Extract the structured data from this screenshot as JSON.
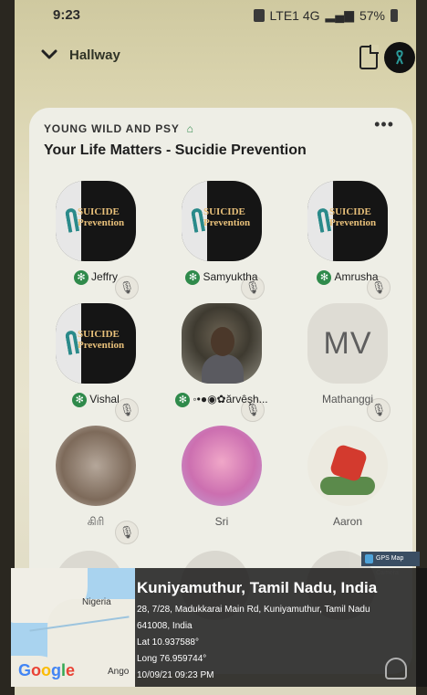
{
  "status_bar": {
    "time": "9:23",
    "network": "LTE1 4G",
    "battery": "57%"
  },
  "header": {
    "room_group": "Hallway"
  },
  "room": {
    "club": "YOUNG WILD AND PSY",
    "title": "Your Life Matters - Sucidie Prevention",
    "more": "•••"
  },
  "poster": {
    "line1": "SUICIDE",
    "line2": "Prevention"
  },
  "speakers": [
    {
      "name": "Jeffry",
      "moderator": true,
      "avatar": "poster"
    },
    {
      "name": "Samyuktha",
      "moderator": true,
      "avatar": "poster"
    },
    {
      "name": "Amrusha",
      "moderator": true,
      "avatar": "poster"
    },
    {
      "name": "Vishal",
      "moderator": true,
      "avatar": "poster"
    },
    {
      "name": "◦•●◉✿ărvêşh...",
      "moderator": true,
      "avatar": "photo"
    },
    {
      "name": "Mathanggi",
      "moderator": false,
      "avatar": "initials",
      "initials": "MV"
    },
    {
      "name": "கிரி",
      "moderator": false,
      "avatar": "photo"
    },
    {
      "name": "Sri",
      "moderator": false,
      "avatar": "photo"
    },
    {
      "name": "Aaron",
      "moderator": false,
      "avatar": "photo"
    }
  ],
  "gps": {
    "badge": "GPS Map Camera",
    "place": "Kuniyamuthur, Tamil Nadu, India",
    "address1": "28, 7/28, Madukkarai Main Rd, Kuniyamuthur, Tamil Nadu",
    "address2": "641008, India",
    "lat": "Lat 10.937588°",
    "long": "Long 76.959744°",
    "datetime": "10/09/21 09:23 PM",
    "map_label_1": "Nigeria",
    "map_label_2": "Ango",
    "map_brand": "Google"
  },
  "colors": {
    "moderator_badge": "#2f8a4b",
    "card_bg": "#eeeee6"
  }
}
